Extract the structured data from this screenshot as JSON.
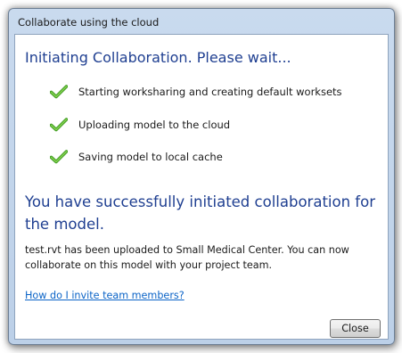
{
  "window": {
    "title": "Collaborate using the cloud"
  },
  "main_instruction": "Initiating Collaboration. Please wait...",
  "steps": [
    {
      "label": "Starting worksharing and creating default worksets",
      "icon": "green-check-icon",
      "status": "complete"
    },
    {
      "label": "Uploading model to the cloud",
      "icon": "green-check-icon",
      "status": "complete"
    },
    {
      "label": "Saving model to local cache",
      "icon": "green-check-icon",
      "status": "complete"
    }
  ],
  "success_heading": "You have successfully initiated collaboration for the model.",
  "info_text": "test.rvt has been uploaded to Small Medical Center. You can now collaborate on this model with your project team.",
  "help_link": "How do I invite team members?",
  "buttons": {
    "close_label": "Close"
  },
  "colors": {
    "heading": "#1f3f91",
    "link": "#0a63c7",
    "check": "#4caf2a",
    "window_frame": "#c9daee"
  }
}
